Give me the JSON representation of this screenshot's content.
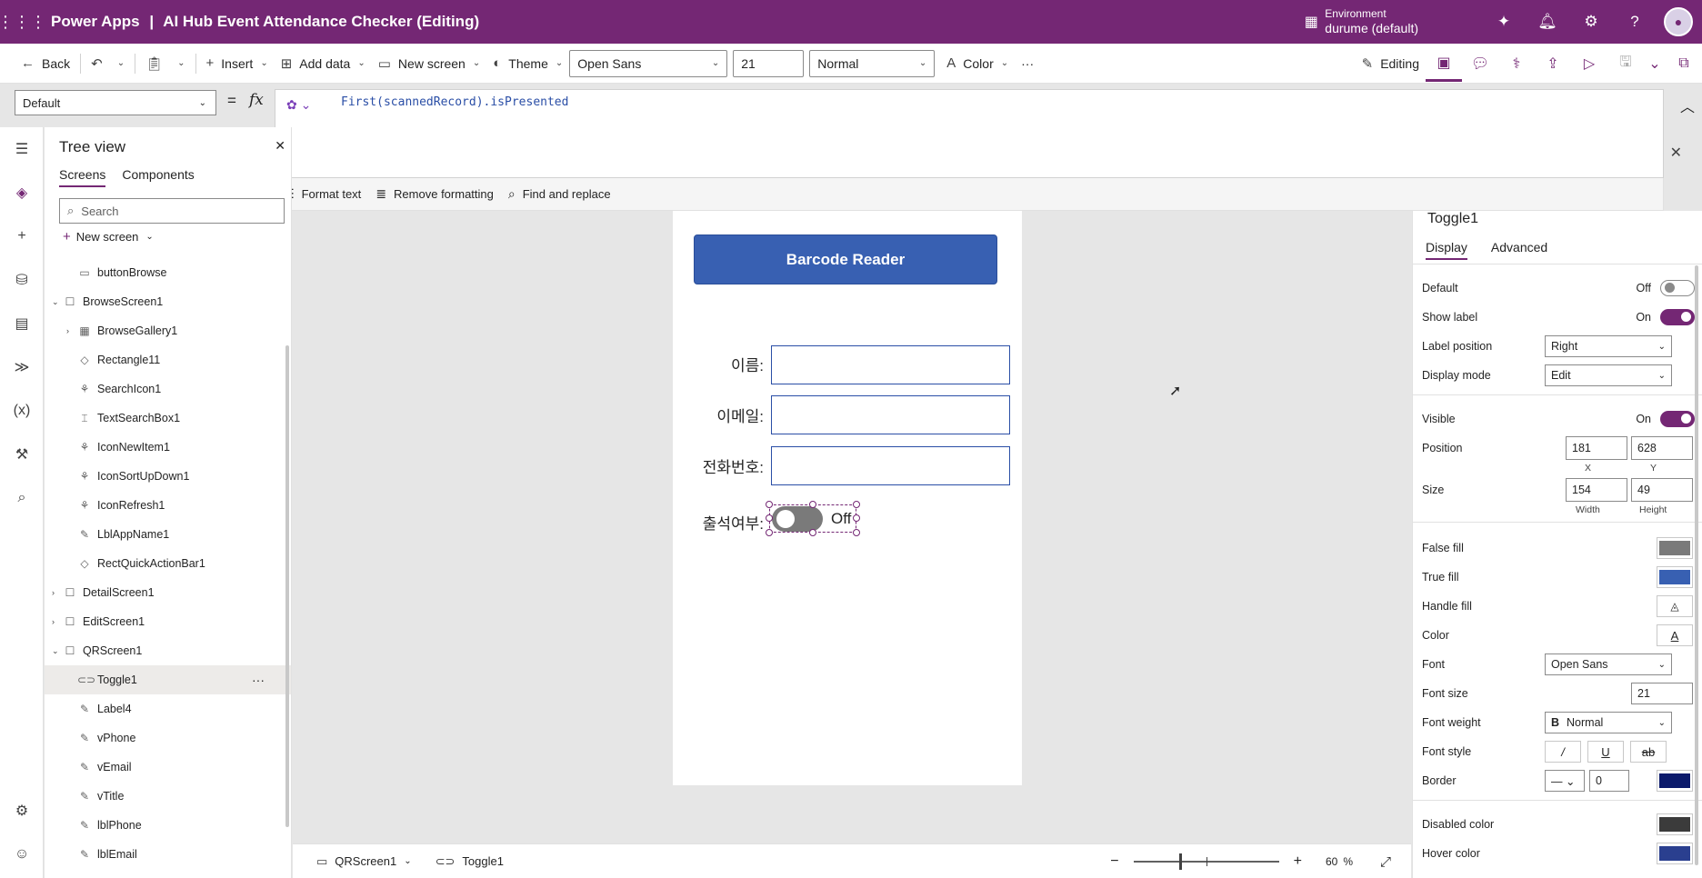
{
  "topbar": {
    "app_name": "Power Apps",
    "separator": "|",
    "app_title": "AI Hub Event Attendance Checker (Editing)",
    "env_label": "Environment",
    "env_value": "durume (default)"
  },
  "cmdbar": {
    "back": "Back",
    "insert": "Insert",
    "add_data": "Add data",
    "new_screen": "New screen",
    "theme": "Theme",
    "font": "Open Sans",
    "font_size": "21",
    "font_weight": "Normal",
    "color": "Color",
    "more": "···",
    "editing": "Editing"
  },
  "formula": {
    "property": "Default",
    "eq": "=",
    "fx": "fx",
    "text": "First(scannedRecord).isPresented",
    "tools": [
      "Format text",
      "Remove formatting",
      "Find and replace"
    ]
  },
  "tree": {
    "title": "Tree view",
    "tabs": [
      "Screens",
      "Components"
    ],
    "search_placeholder": "Search",
    "new_screen": "New screen",
    "items": [
      {
        "label": "buttonBrowse",
        "level": 2,
        "icon": "button-icon"
      },
      {
        "label": "BrowseScreen1",
        "level": 1,
        "icon": "screen-icon",
        "expander": "down"
      },
      {
        "label": "BrowseGallery1",
        "level": 2,
        "icon": "gallery-icon",
        "expander": "right"
      },
      {
        "label": "Rectangle11",
        "level": 2,
        "icon": "shape-icon"
      },
      {
        "label": "SearchIcon1",
        "level": 2,
        "icon": "icon-control-icon"
      },
      {
        "label": "TextSearchBox1",
        "level": 2,
        "icon": "textinput-icon"
      },
      {
        "label": "IconNewItem1",
        "level": 2,
        "icon": "icon-control-icon"
      },
      {
        "label": "IconSortUpDown1",
        "level": 2,
        "icon": "icon-control-icon"
      },
      {
        "label": "IconRefresh1",
        "level": 2,
        "icon": "icon-control-icon"
      },
      {
        "label": "LblAppName1",
        "level": 2,
        "icon": "label-icon"
      },
      {
        "label": "RectQuickActionBar1",
        "level": 2,
        "icon": "shape-icon"
      },
      {
        "label": "DetailScreen1",
        "level": 1,
        "icon": "screen-icon",
        "expander": "right"
      },
      {
        "label": "EditScreen1",
        "level": 1,
        "icon": "screen-icon",
        "expander": "right"
      },
      {
        "label": "QRScreen1",
        "level": 1,
        "icon": "screen-icon",
        "expander": "down"
      },
      {
        "label": "Toggle1",
        "level": 2,
        "icon": "toggle-icon",
        "selected": true
      },
      {
        "label": "Label4",
        "level": 2,
        "icon": "label-icon"
      },
      {
        "label": "vPhone",
        "level": 2,
        "icon": "label-icon"
      },
      {
        "label": "vEmail",
        "level": 2,
        "icon": "label-icon"
      },
      {
        "label": "vTitle",
        "level": 2,
        "icon": "label-icon"
      },
      {
        "label": "lblPhone",
        "level": 2,
        "icon": "label-icon"
      },
      {
        "label": "lblEmail",
        "level": 2,
        "icon": "label-icon"
      }
    ],
    "more": "···"
  },
  "canvas": {
    "barcode_button": "Barcode Reader",
    "name_label": "이름:",
    "email_label": "이메일:",
    "phone_label": "전화번호:",
    "attendance_label": "출석여부:",
    "toggle_text": "Off"
  },
  "status": {
    "screen": "QRScreen1",
    "control": "Toggle1",
    "zoom_value": "60",
    "zoom_unit": "%"
  },
  "props": {
    "name": "Toggle1",
    "tabs": [
      "Display",
      "Advanced"
    ],
    "default_label": "Default",
    "default_state": "Off",
    "show_label": "Show label",
    "show_label_state": "On",
    "label_position": "Label position",
    "label_position_value": "Right",
    "display_mode": "Display mode",
    "display_mode_value": "Edit",
    "visible": "Visible",
    "visible_state": "On",
    "position": "Position",
    "pos_x": "181",
    "pos_y": "628",
    "x_label": "X",
    "y_label": "Y",
    "size": "Size",
    "width": "154",
    "height": "49",
    "width_label": "Width",
    "height_label": "Height",
    "false_fill": "False fill",
    "true_fill": "True fill",
    "handle_fill": "Handle fill",
    "color": "Color",
    "font": "Font",
    "font_value": "Open Sans",
    "font_size": "Font size",
    "font_size_value": "21",
    "font_weight": "Font weight",
    "font_weight_value": "Normal",
    "font_style": "Font style",
    "border": "Border",
    "border_value": "0",
    "disabled_color": "Disabled color",
    "hover_color": "Hover color"
  },
  "colors": {
    "brand": "#742774",
    "false_fill": "#7a7a7a",
    "true_fill": "#3860b2",
    "border_color": "#0b1a6b",
    "disabled_color": "#3b3b3b",
    "hover_color": "#2a3f8f"
  }
}
